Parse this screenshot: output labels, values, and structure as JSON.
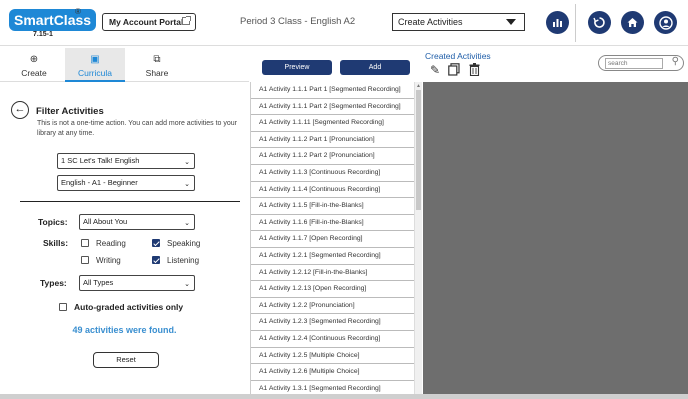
{
  "header": {
    "logo_text_a": "Smart",
    "logo_text_b": "Class",
    "logo_reg": "®",
    "version": "7.15-1",
    "portal_label": "My Account Portal",
    "class_title": "Period 3 Class - English A2",
    "activity_select": "Create Activities",
    "icons": [
      "chart-icon",
      "history-icon",
      "home-icon",
      "account-icon"
    ]
  },
  "tabs": [
    {
      "label": "Create",
      "icon": "⊕"
    },
    {
      "label": "Curricula",
      "icon": "▣"
    },
    {
      "label": "Share",
      "icon": "⧉"
    }
  ],
  "filter": {
    "title": "Filter Activities",
    "description": "This is not a one-time action. You can add more activities to your library at any time.",
    "curriculum": "1 SC Let's Talk! English",
    "level": "English - A1 - Beginner",
    "topics_label": "Topics:",
    "topics_value": "All About You",
    "skills_label": "Skills:",
    "skills": [
      {
        "label": "Reading",
        "checked": false
      },
      {
        "label": "Speaking",
        "checked": true
      },
      {
        "label": "Writing",
        "checked": false
      },
      {
        "label": "Listening",
        "checked": true
      }
    ],
    "types_label": "Types:",
    "types_value": "All Types",
    "autograded_label": "Auto-graded activities only",
    "found_text": "49 activities were found.",
    "reset_label": "Reset"
  },
  "actions": {
    "preview_label": "Preview",
    "add_label": "Add"
  },
  "activities": [
    "A1 Activity 1.1.1 Part 1 [Segmented Recording]",
    "A1 Activity 1.1.1 Part 2 [Segmented Recording]",
    "A1 Activity 1.1.11 [Segmented Recording]",
    "A1 Activity 1.1.2 Part 1 [Pronunciation]",
    "A1 Activity 1.1.2 Part 2 [Pronunciation]",
    "A1 Activity 1.1.3 [Continuous Recording]",
    "A1 Activity 1.1.4 [Continuous Recording]",
    "A1 Activity 1.1.5 [Fill-in-the-Blanks]",
    "A1 Activity 1.1.6 [Fill-in-the-Blanks]",
    "A1 Activity 1.1.7 [Open Recording]",
    "A1 Activity 1.2.1 [Segmented Recording]",
    "A1 Activity 1.2.12 [Fill-in-the-Blanks]",
    "A1 Activity 1.2.13 [Open Recording]",
    "A1 Activity 1.2.2 [Pronunciation]",
    "A1 Activity 1.2.3 [Segmented Recording]",
    "A1 Activity 1.2.4 [Continuous Recording]",
    "A1 Activity 1.2.5 [Multiple Choice]",
    "A1 Activity 1.2.6 [Multiple Choice]",
    "A1 Activity 1.3.1 [Segmented Recording]"
  ],
  "created": {
    "label": "Created Activities",
    "search_placeholder": "search"
  }
}
